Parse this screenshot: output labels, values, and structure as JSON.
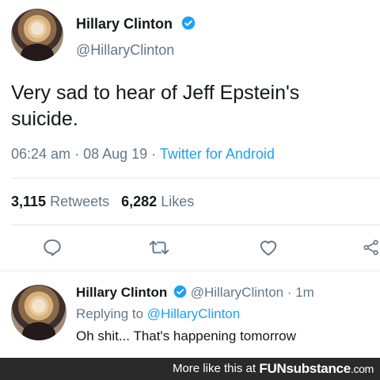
{
  "tweet": {
    "author_name": "Hillary Clinton",
    "author_handle": "@HillaryClinton",
    "text": "Very sad to hear of Jeff Epstein's suicide.",
    "time": "06:24 am",
    "separator": " · ",
    "date": "08 Aug 19",
    "client": "Twitter for Android",
    "retweets_count": "3,115",
    "retweets_label": "Retweets",
    "likes_count": "6,282",
    "likes_label": "Likes",
    "actions": [
      "reply-icon",
      "retweet-icon",
      "like-icon",
      "share-icon"
    ]
  },
  "reply": {
    "author_name": "Hillary Clinton",
    "author_handle": "@HillaryClinton",
    "age": "· 1m",
    "replying_prefix": "Replying to",
    "replying_to": "@HillaryClinton",
    "text": "Oh shit... That's happening tomorrow"
  },
  "footer": {
    "more_text": "More like this at",
    "brand_main": "FUNsubstance",
    "brand_suffix": ".com"
  },
  "colors": {
    "accent": "#1da1f2",
    "muted": "#657786",
    "text": "#14171a",
    "divider": "#e1e8ed",
    "footer_bg": "#2a2a2a"
  }
}
